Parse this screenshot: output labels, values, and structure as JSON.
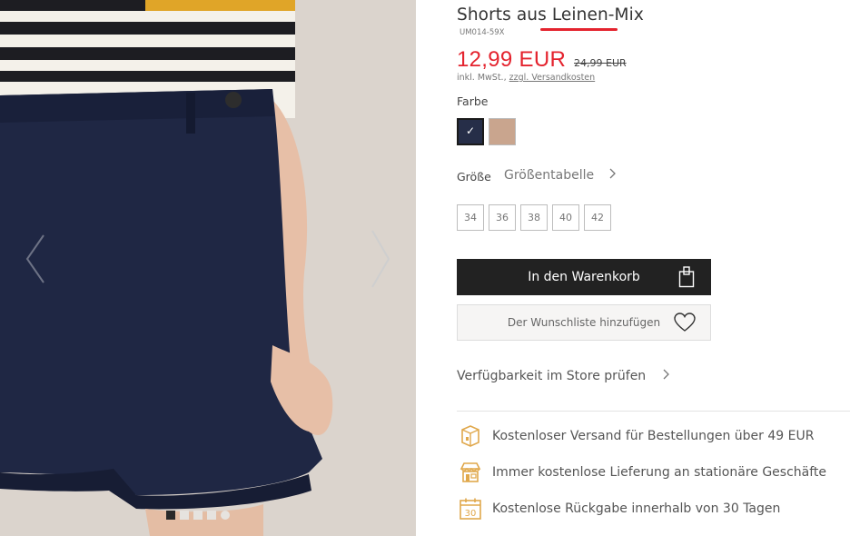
{
  "product": {
    "title": "Shorts aus Leinen-Mix",
    "sku": "UM014-59X",
    "price": "12,99 EUR",
    "old_price": "24,99 EUR",
    "tax_prefix": "inkl. MwSt.,",
    "shipping_link": "zzgl. Versandkosten"
  },
  "color": {
    "label": "Farbe",
    "swatches": [
      {
        "name": "navy",
        "hex": "#262e48",
        "selected": true
      },
      {
        "name": "beige",
        "hex": "#c9a58e",
        "selected": false
      }
    ],
    "check_glyph": "✓"
  },
  "size": {
    "label": "Größe",
    "table_link": "Größentabelle",
    "options": [
      "34",
      "36",
      "38",
      "40",
      "42"
    ]
  },
  "actions": {
    "add_to_cart": "In den Warenkorb",
    "add_to_wishlist": "Der Wunschliste hinzufügen",
    "store_availability": "Verfügbarkeit im Store prüfen"
  },
  "perks": [
    {
      "icon": "shipping-box-icon",
      "text": "Kostenloser Versand für Bestellungen über 49 EUR"
    },
    {
      "icon": "store-icon",
      "text": "Immer kostenlose Lieferung an stationäre Geschäfte"
    },
    {
      "icon": "calendar-30-icon",
      "text": "Kostenlose Rückgabe innerhalb von 30 Tagen",
      "badge": "30"
    }
  ],
  "gallery": {
    "image_count": 5,
    "active_index": 0
  },
  "colors": {
    "accent_red": "#e4232e",
    "perk_icon": "#e0a84c",
    "button_dark": "#222222"
  }
}
